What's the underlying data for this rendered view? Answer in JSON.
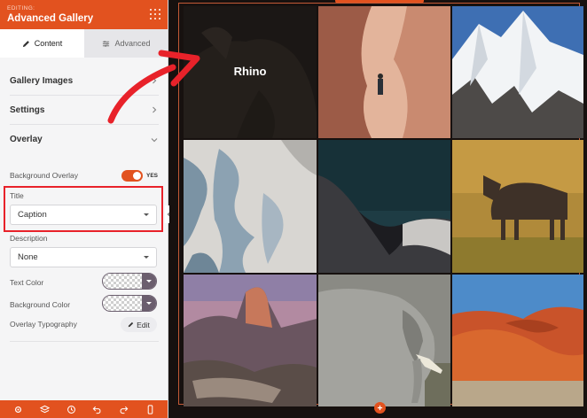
{
  "header": {
    "editing_label": "EDITING:",
    "title": "Advanced Gallery"
  },
  "tabs": [
    {
      "label": "Content",
      "active": true
    },
    {
      "label": "Advanced",
      "active": false
    }
  ],
  "sections": [
    {
      "label": "Gallery Images",
      "expanded": false
    },
    {
      "label": "Settings",
      "expanded": false
    },
    {
      "label": "Overlay",
      "expanded": true
    }
  ],
  "overlay": {
    "background_overlay_label": "Background Overlay",
    "background_overlay_state": "YES",
    "title_label": "Title",
    "title_value": "Caption",
    "description_label": "Description",
    "description_value": "None",
    "text_color_label": "Text Color",
    "background_color_label": "Background Color",
    "typography_label": "Overlay Typography",
    "edit_label": "Edit"
  },
  "gallery": {
    "images": [
      {
        "subject": "rhino",
        "caption": "Rhino",
        "overlay_shown": true
      },
      {
        "subject": "canyon",
        "caption": "",
        "overlay_shown": false
      },
      {
        "subject": "snowy-mountain",
        "caption": "",
        "overlay_shown": false
      },
      {
        "subject": "ice-rock",
        "caption": "",
        "overlay_shown": false
      },
      {
        "subject": "night-mountain",
        "caption": "",
        "overlay_shown": false
      },
      {
        "subject": "moose",
        "caption": "",
        "overlay_shown": false
      },
      {
        "subject": "half-dome",
        "caption": "",
        "overlay_shown": false
      },
      {
        "subject": "elephant",
        "caption": "",
        "overlay_shown": false
      },
      {
        "subject": "desert-dunes",
        "caption": "",
        "overlay_shown": false
      }
    ]
  },
  "colors": {
    "brand": "#e2521f",
    "highlight_box": "#e8222a",
    "arrow": "#e8222a",
    "panel_bg": "#f5f5f6",
    "canvas_bg": "#17110f"
  },
  "icons": {
    "header_menu": "grid-dots-icon",
    "content_tab": "pencil-icon",
    "advanced_tab": "sliders-icon",
    "section_collapsed": "chevron-right-icon",
    "section_expanded": "chevron-down-icon",
    "bottom_bar": [
      "gear-icon",
      "layers-icon",
      "history-icon",
      "undo-icon",
      "redo-icon",
      "mobile-icon"
    ]
  }
}
